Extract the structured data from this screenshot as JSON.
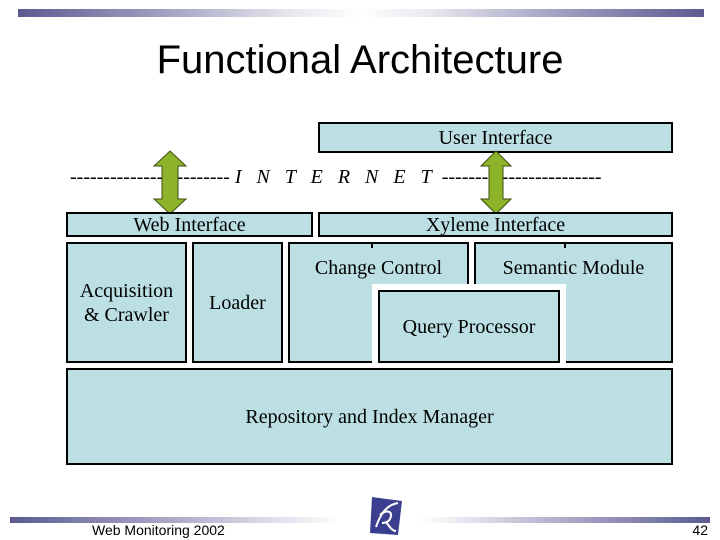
{
  "slide": {
    "title": "Functional Architecture",
    "footer_text": "Web Monitoring 2002",
    "page_number": "42",
    "logo_icon": "inria-logo-icon"
  },
  "diagram": {
    "user_interface": "User Interface",
    "internet_left_dashes": "------------------------",
    "internet_label": "I N T E R N E T",
    "internet_right_dashes": "------------------------",
    "web_interface": "Web Interface",
    "xyleme_interface": "Xyleme Interface",
    "acquisition_line1": "Acquisition",
    "acquisition_line2": "& Crawler",
    "loader": "Loader",
    "change_control": "Change Control",
    "semantic_module": "Semantic Module",
    "query_processor": "Query Processor",
    "repository": "Repository and Index Manager",
    "arrows": [
      "web-interface-internet-arrow",
      "xyleme-user-interface-arrow"
    ],
    "colors": {
      "box_fill": "#bbdfe2",
      "arrow_fill": "#8db32b",
      "bar_color": "#5b5b91"
    }
  }
}
